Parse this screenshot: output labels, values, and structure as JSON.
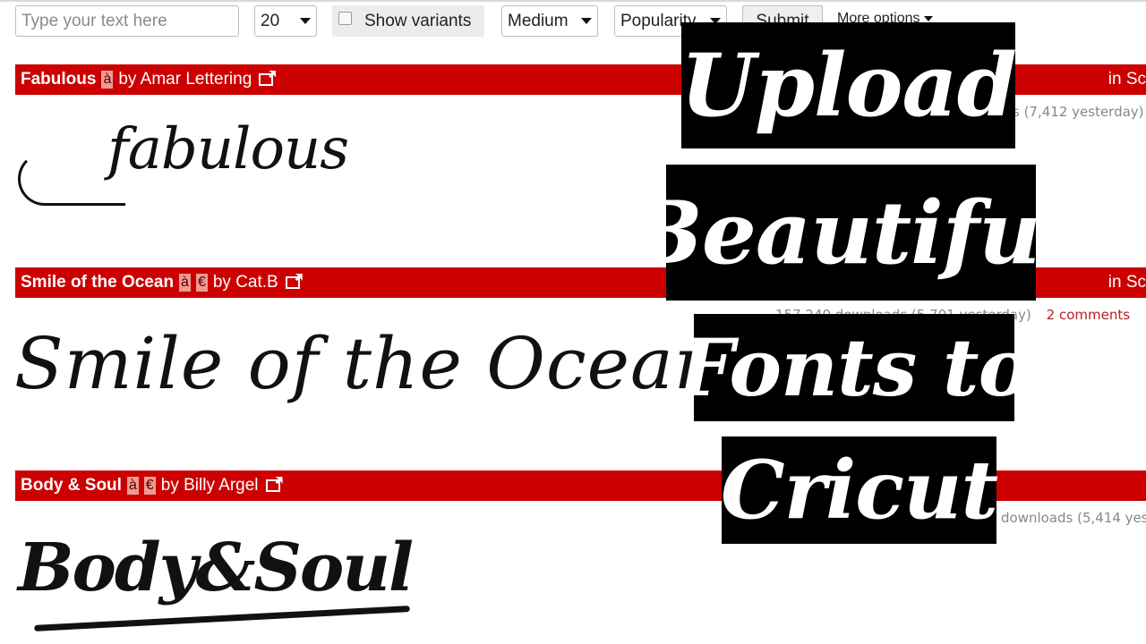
{
  "toolbar": {
    "text_input": {
      "placeholder": "Type your text here",
      "value": ""
    },
    "count_select": {
      "value": "20"
    },
    "show_variants": {
      "label": "Show variants",
      "checked": false
    },
    "size_select": {
      "value": "Medium"
    },
    "sort_select": {
      "value": "Popularity"
    },
    "submit_label": "Submit",
    "more_options_label": "More options"
  },
  "fonts": [
    {
      "name": "Fabulous",
      "badges": [
        "à"
      ],
      "author": "by Amar Lettering",
      "category": "in Sc",
      "stats": "s (7,412 yesterday)",
      "preview_text": "fabulous"
    },
    {
      "name": "Smile of the Ocean",
      "badges": [
        "à",
        "€"
      ],
      "author": "by Cat.B",
      "category": "in Sc",
      "stats": "157,240 downloads (5,701 yesterday)",
      "comments": "2 comments",
      "preview_text": "Smile of the Ocean"
    },
    {
      "name": "Body & Soul",
      "badges": [
        "à",
        "€"
      ],
      "author": "by Billy Argel",
      "stats": "downloads (5,414 yes",
      "preview_text": "Body&Soul"
    }
  ],
  "overlay_title": {
    "lines": [
      "Upload",
      "Beautiful",
      "Fonts to",
      "Cricut"
    ]
  },
  "colors": {
    "bar_red": "#cc0000",
    "badge_pink": "#f19a94",
    "overlay_black": "#000000",
    "comments_red": "#b82020"
  }
}
